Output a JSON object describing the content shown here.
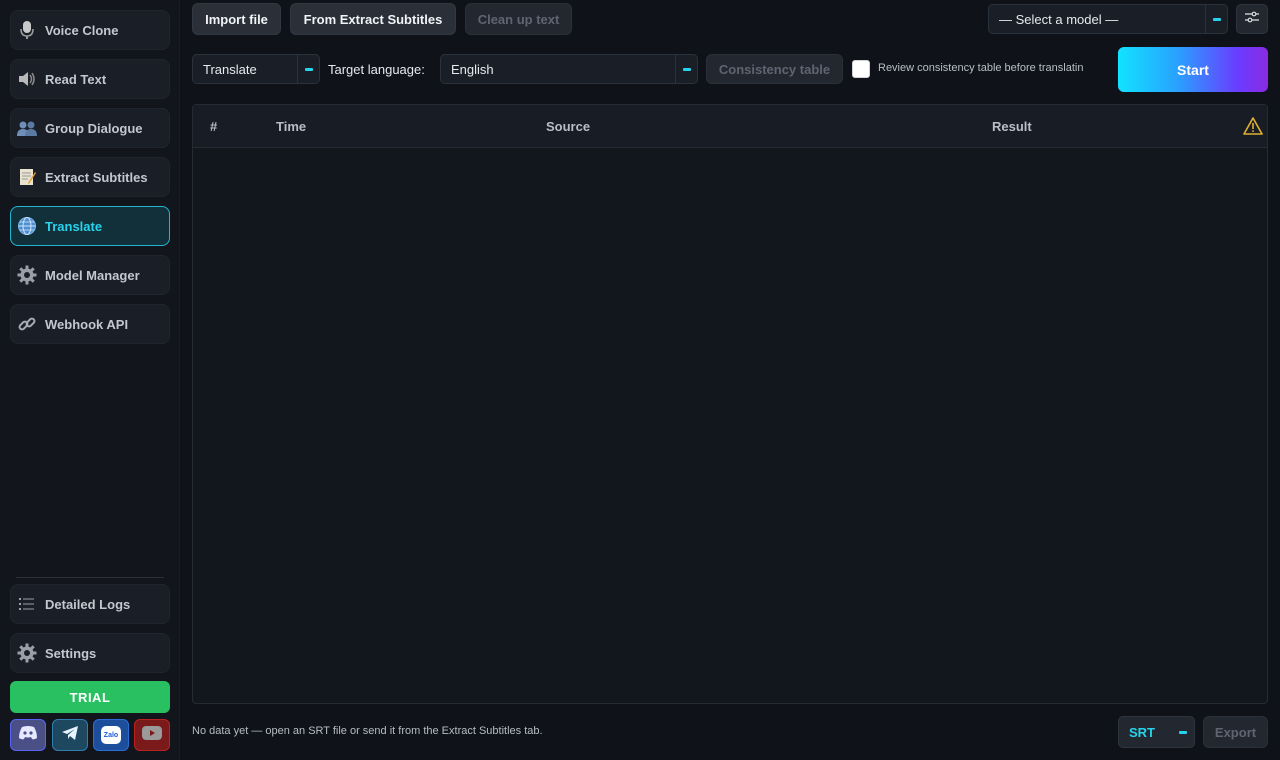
{
  "sidebar": {
    "items": [
      {
        "label": "Voice Clone",
        "icon": "microphone-icon"
      },
      {
        "label": "Read Text",
        "icon": "speaker-icon"
      },
      {
        "label": "Group Dialogue",
        "icon": "users-icon"
      },
      {
        "label": "Extract Subtitles",
        "icon": "memo-icon"
      },
      {
        "label": "Translate",
        "icon": "globe-icon"
      },
      {
        "label": "Model Manager",
        "icon": "gear-icon"
      },
      {
        "label": "Webhook API",
        "icon": "link-icon"
      }
    ],
    "bottom_items": [
      {
        "label": "Detailed Logs",
        "icon": "list-icon"
      },
      {
        "label": "Settings",
        "icon": "gear-icon"
      }
    ],
    "trial_label": "TRIAL",
    "social": [
      "discord-icon",
      "telegram-icon",
      "zalo-icon",
      "youtube-icon"
    ],
    "zalo_text": "Zalo"
  },
  "toolbar": {
    "import_label": "Import file",
    "from_extract_label": "From Extract Subtitles",
    "cleanup_label": "Clean up text",
    "model_select": "— Select a model —"
  },
  "controls": {
    "mode_select": "Translate",
    "target_language_label": "Target language:",
    "target_language_value": "English",
    "consistency_label": "Consistency table",
    "review_label": "Review consistency table before translatin",
    "review_checked": false,
    "start_label": "Start"
  },
  "table": {
    "columns": [
      "#",
      "Time",
      "Source",
      "Result"
    ]
  },
  "footer": {
    "status": "No data yet — open an SRT file or send it from the Extract Subtitles tab.",
    "format_select": "SRT",
    "export_label": "Export"
  },
  "colors": {
    "accent": "#27d3ec",
    "trial": "#28c060",
    "warning": "#e0b030"
  }
}
